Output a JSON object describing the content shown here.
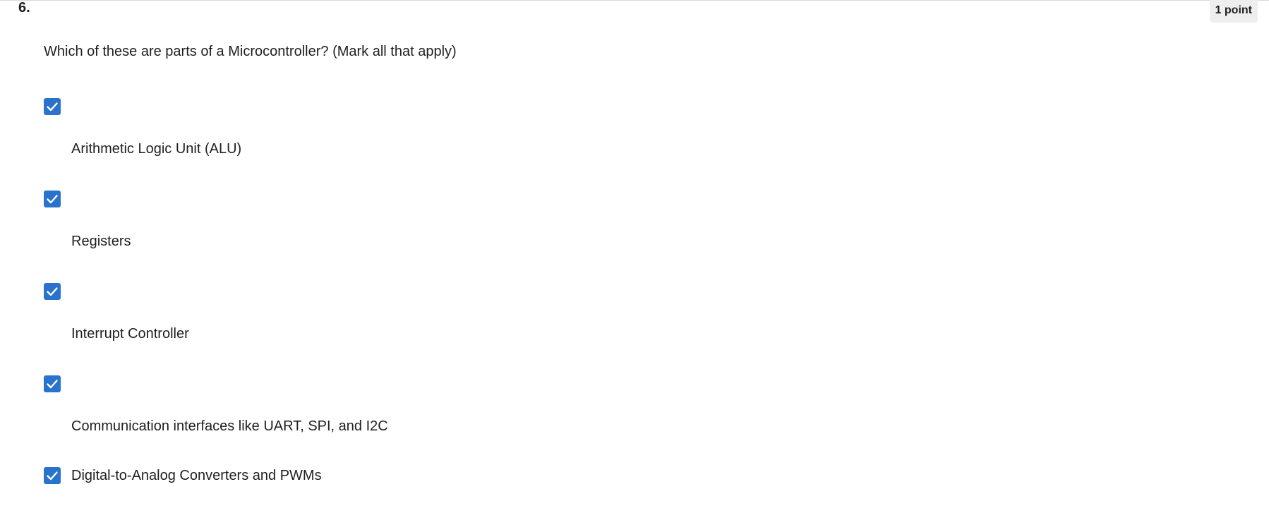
{
  "question": {
    "number": "6.",
    "points": "1 point",
    "text": "Which of these are parts of a Microcontroller? (Mark all that apply)"
  },
  "options": [
    {
      "label": "Arithmetic Logic Unit (ALU)",
      "checked": true
    },
    {
      "label": "Registers",
      "checked": true
    },
    {
      "label": "Interrupt Controller",
      "checked": true
    },
    {
      "label": "Communication interfaces like UART, SPI, and I2C",
      "checked": true
    },
    {
      "label": "Digital-to-Analog Converters and PWMs",
      "checked": true
    }
  ],
  "colors": {
    "checkbox_fill": "#2a73cc",
    "badge_bg": "#eeeeee"
  },
  "icons": {
    "checkbox": "check-icon"
  }
}
